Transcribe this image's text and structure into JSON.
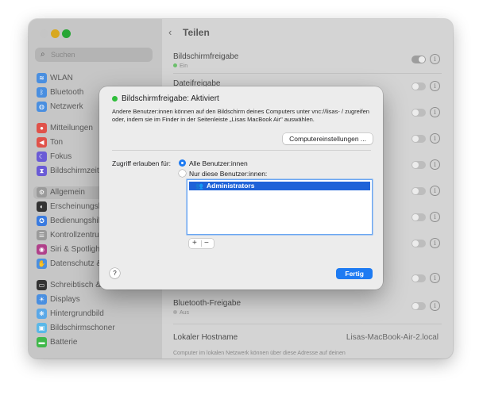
{
  "sidebar": {
    "search_placeholder": "Suchen",
    "items": [
      {
        "label": "WLAN",
        "icon": "wifi-icon",
        "color": "#4a8fe0"
      },
      {
        "label": "Bluetooth",
        "icon": "bluetooth-icon",
        "color": "#4a8fe0"
      },
      {
        "label": "Netzwerk",
        "icon": "globe-icon",
        "color": "#4a8fe0"
      },
      {
        "label": "Mitteilungen",
        "icon": "bell-icon",
        "color": "#e0524a"
      },
      {
        "label": "Ton",
        "icon": "speaker-icon",
        "color": "#e0524a"
      },
      {
        "label": "Fokus",
        "icon": "moon-icon",
        "color": "#6a5bd6"
      },
      {
        "label": "Bildschirmzeit",
        "icon": "hourglass-icon",
        "color": "#6a5bd6"
      },
      {
        "label": "Allgemein",
        "icon": "gear-icon",
        "color": "#9a9a9a"
      },
      {
        "label": "Erscheinungsbild",
        "icon": "appearance-icon",
        "color": "#333333"
      },
      {
        "label": "Bedienungshilfen",
        "icon": "accessibility-icon",
        "color": "#3a7be0"
      },
      {
        "label": "Kontrollzentrum",
        "icon": "control-center-icon",
        "color": "#9a9a9a"
      },
      {
        "label": "Siri & Spotlight",
        "icon": "siri-icon",
        "color": "#b0408a"
      },
      {
        "label": "Datenschutz & Sicherheit",
        "icon": "hand-icon",
        "color": "#4a8fe0"
      },
      {
        "label": "Schreibtisch & Dock",
        "icon": "dock-icon",
        "color": "#333333"
      },
      {
        "label": "Displays",
        "icon": "sun-icon",
        "color": "#4a8fe0"
      },
      {
        "label": "Hintergrundbild",
        "icon": "wallpaper-icon",
        "color": "#5aa8e8"
      },
      {
        "label": "Bildschirmschoner",
        "icon": "screensaver-icon",
        "color": "#5ab8e8"
      },
      {
        "label": "Batterie",
        "icon": "battery-icon",
        "color": "#3fb84a"
      }
    ]
  },
  "header": {
    "back_icon": "chevron-left-icon",
    "title": "Teilen"
  },
  "rows": [
    {
      "title": "Bildschirmfreigabe",
      "status": "Ein"
    },
    {
      "title": "Dateifreigabe"
    },
    {
      "title": "Bluetooth-Freigabe",
      "status": "Aus"
    }
  ],
  "hostname": {
    "label": "Lokaler Hostname",
    "value": "Lisas-MacBook-Air-2.local",
    "description": "Computer im lokalen Netzwerk können über diese Adresse auf deinen"
  },
  "dialog": {
    "title": "Bildschirmfreigabe: Aktiviert",
    "description": "Andere Benutzer:innen können auf den Bildschirm deines Computers unter vnc://lisas-                    / zugreifen oder, indem sie im Finder in der Seitenleiste „Lisas MacBook Air\" auswählen.",
    "settings_button": "Computereinstellungen ...",
    "access_label": "Zugriff erlauben für:",
    "radio_all": "Alle Benutzer:innen",
    "radio_only": "Nur diese Benutzer:innen:",
    "users": [
      "Administrators"
    ],
    "add_label": "+",
    "remove_label": "−",
    "help_label": "?",
    "done_button": "Fertig",
    "status_color": "#2fbe3b",
    "accent_color": "#1e7bf2"
  }
}
